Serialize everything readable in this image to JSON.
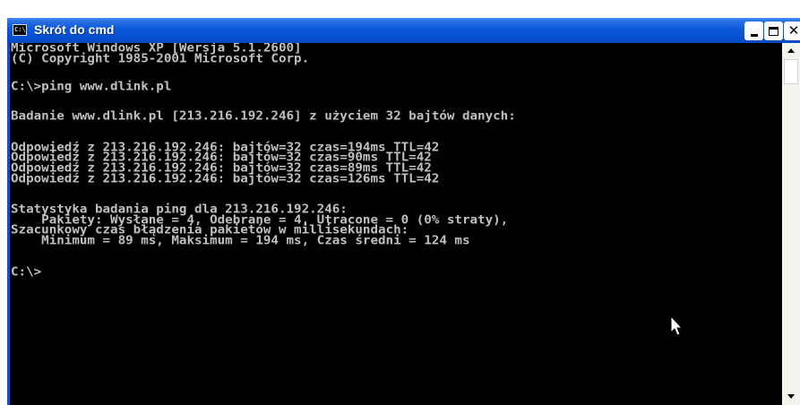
{
  "window": {
    "title": "Skrót do cmd",
    "icon_text": "C:\\",
    "controls": [
      "minimize-icon",
      "maximize-icon",
      "close-icon"
    ],
    "close_glyph": "✕"
  },
  "console": {
    "lines": [
      "Microsoft Windows XP [Wersja 5.1.2600]",
      "(C) Copyright 1985-2001 Microsoft Corp.",
      "",
      "C:\\>ping www.dlink.pl",
      "",
      "Badanie www.dlink.pl [213.216.192.246] z użyciem 32 bajtów danych:",
      "",
      "Odpowiedź z 213.216.192.246: bajtów=32 czas=194ms TTL=42",
      "Odpowiedź z 213.216.192.246: bajtów=32 czas=90ms TTL=42",
      "Odpowiedź z 213.216.192.246: bajtów=32 czas=89ms TTL=42",
      "Odpowiedź z 213.216.192.246: bajtów=32 czas=126ms TTL=42",
      "",
      "Statystyka badania ping dla 213.216.192.246:",
      "    Pakiety: Wysłane = 4, Odebrane = 4, Utracone = 0 (0% straty),",
      "Szacunkowy czas błądzenia pakietów w millisekundach:",
      "    Minimum = 89 ms, Maksimum = 194 ms, Czas średni = 124 ms",
      "",
      "C:\\>"
    ]
  },
  "colors": {
    "titlebar": "#0753d6",
    "console_bg": "#000000",
    "console_text": "#c0c0c0"
  }
}
